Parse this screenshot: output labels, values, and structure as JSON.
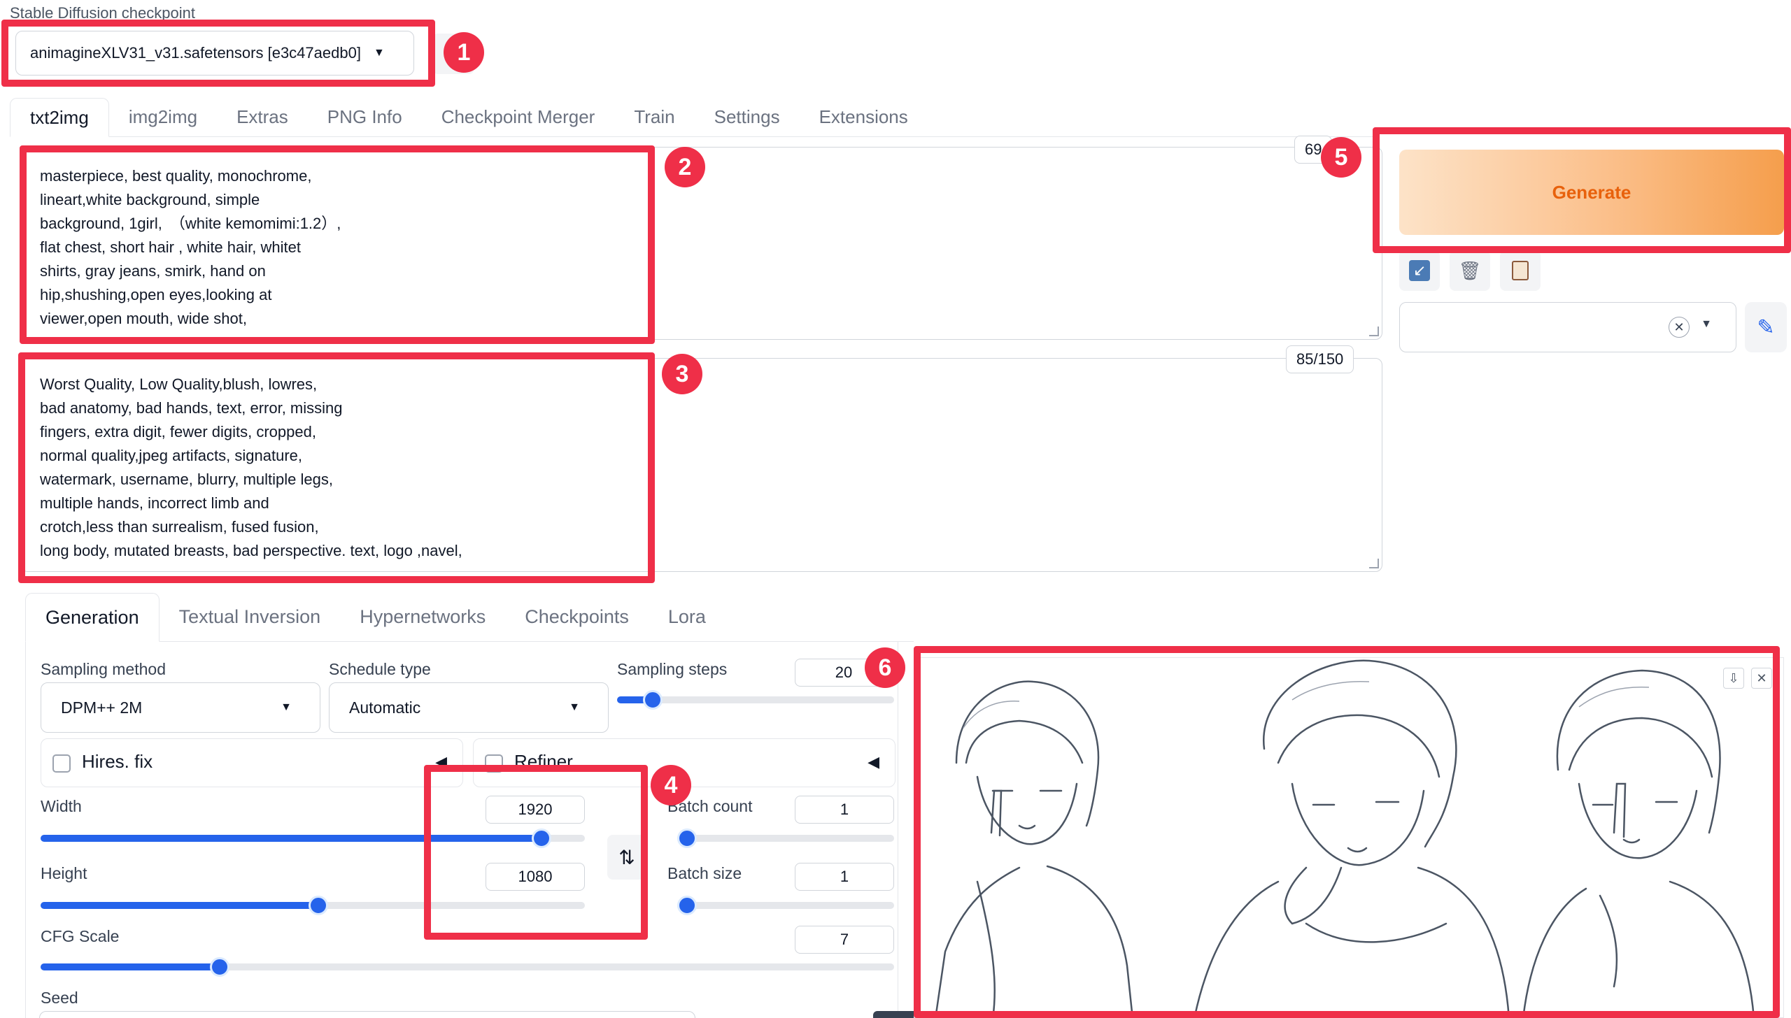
{
  "checkpoint": {
    "label": "Stable Diffusion checkpoint",
    "value": "animagineXLV31_v31.safetensors [e3c47aedb0]"
  },
  "top_tabs": [
    "txt2img",
    "img2img",
    "Extras",
    "PNG Info",
    "Checkpoint Merger",
    "Train",
    "Settings",
    "Extensions"
  ],
  "prompt": {
    "text": "masterpiece, best quality, monochrome,\nlineart,white background, simple\nbackground, 1girl,　（white kemomimi:1.2）,\nflat chest, short hair , white hair, whitet\nshirts, gray jeans, smirk, hand on\nhip,shushing,open eyes,looking at\nviewer,open mouth, wide shot,",
    "token_count": "69"
  },
  "negative_prompt": {
    "text": "Worst Quality, Low Quality,blush, lowres,\nbad anatomy, bad hands, text, error, missing\nfingers, extra digit, fewer digits, cropped,\nnormal quality,jpeg artifacts, signature,\nwatermark, username, blurry, multiple legs,\nmultiple hands, incorrect limb and\ncrotch,less than surrealism, fused fusion,\nlong body, mutated breasts, bad perspective. text, logo ,navel,",
    "token_count": "85/150"
  },
  "generate": {
    "label": "Generate"
  },
  "sub_tabs": [
    "Generation",
    "Textual Inversion",
    "Hypernetworks",
    "Checkpoints",
    "Lora"
  ],
  "sampling_method": {
    "label": "Sampling method",
    "value": "DPM++ 2M"
  },
  "schedule_type": {
    "label": "Schedule type",
    "value": "Automatic"
  },
  "sampling_steps": {
    "label": "Sampling steps",
    "value": "20",
    "fraction": 0.13
  },
  "hires_fix": {
    "label": "Hires. fix"
  },
  "refiner": {
    "label": "Refiner"
  },
  "width": {
    "label": "Width",
    "value": "1920",
    "fraction": 0.92
  },
  "height": {
    "label": "Height",
    "value": "1080",
    "fraction": 0.51
  },
  "batch_count": {
    "label": "Batch count",
    "value": "1",
    "fraction": 0.0
  },
  "batch_size": {
    "label": "Batch size",
    "value": "1",
    "fraction": 0.0
  },
  "cfg_scale": {
    "label": "CFG Scale",
    "value": "7",
    "fraction": 0.21
  },
  "seed": {
    "label": "Seed"
  },
  "annotations": [
    "1",
    "2",
    "3",
    "4",
    "5",
    "6"
  ],
  "colors": {
    "accent": "#2563eb",
    "annotation": "#ef2f48",
    "generate_text": "#e8610c"
  }
}
